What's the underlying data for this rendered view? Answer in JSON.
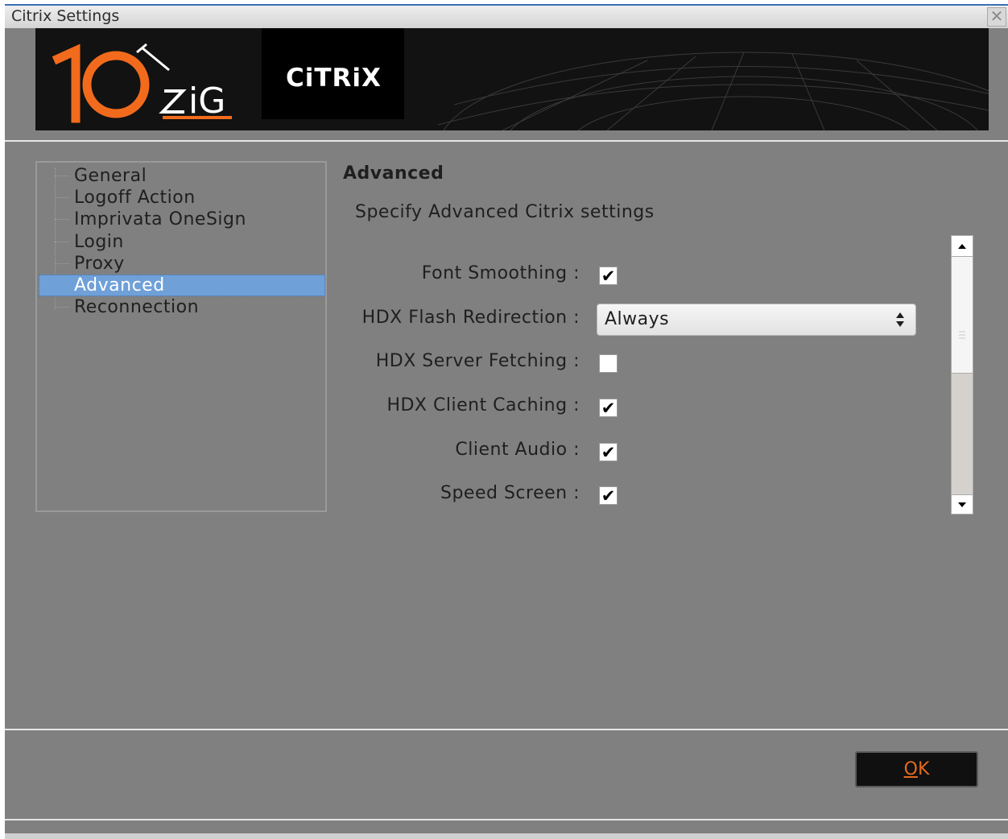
{
  "window": {
    "title": "Citrix Settings",
    "close_symbol": "✕"
  },
  "banner": {
    "logo_text": "10ZiG",
    "citrix_logo": "CiTRiX"
  },
  "nav": {
    "items": [
      {
        "label": "General"
      },
      {
        "label": "Logoff Action"
      },
      {
        "label": "Imprivata OneSign"
      },
      {
        "label": "Login"
      },
      {
        "label": "Proxy"
      },
      {
        "label": "Advanced",
        "selected": true
      },
      {
        "label": "Reconnection"
      }
    ]
  },
  "panel": {
    "title": "Advanced",
    "description": "Specify Advanced Citrix settings",
    "settings": [
      {
        "label": "Font Smoothing :",
        "type": "checkbox",
        "checked": true
      },
      {
        "label": "HDX Flash Redirection :",
        "type": "select",
        "value": "Always"
      },
      {
        "label": "HDX Server Fetching :",
        "type": "checkbox",
        "checked": false
      },
      {
        "label": "HDX Client Caching :",
        "type": "checkbox",
        "checked": true
      },
      {
        "label": "Client Audio :",
        "type": "checkbox",
        "checked": true
      },
      {
        "label": "Speed Screen :",
        "type": "checkbox",
        "checked": true
      }
    ],
    "checkmark": "✔"
  },
  "footer": {
    "ok_label_u": "O",
    "ok_label_rest": "K"
  },
  "colors": {
    "accent": "#e46a1c",
    "selection": "#6fa0d8",
    "background": "#808080"
  }
}
